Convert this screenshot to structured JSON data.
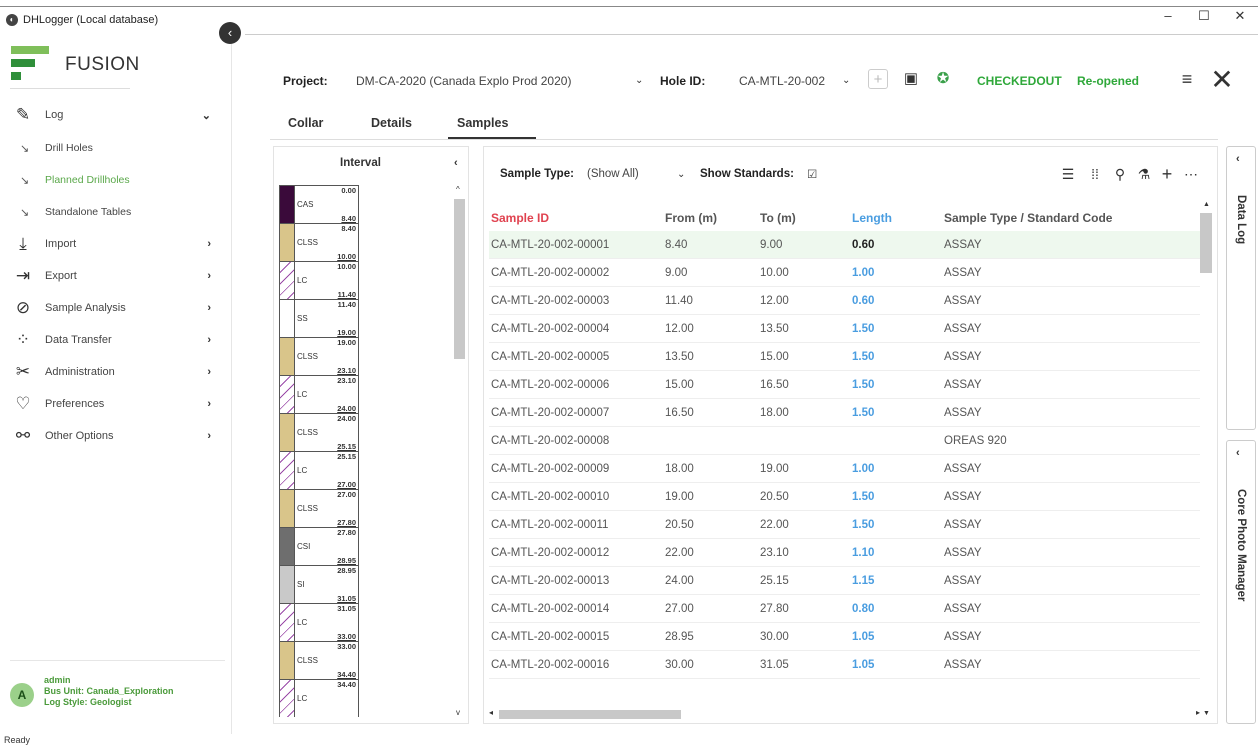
{
  "window": {
    "title": "DHLogger (Local database)",
    "minimize": "–",
    "maximize": "☐",
    "close": "✕"
  },
  "app": {
    "logo_text": "FUSION"
  },
  "nav": {
    "log": "Log",
    "sub": [
      "Drill Holes",
      "Planned Drillholes",
      "Standalone Tables"
    ],
    "items": [
      "Import",
      "Export",
      "Sample Analysis",
      "Data Transfer",
      "Administration",
      "Preferences",
      "Other Options"
    ]
  },
  "user": {
    "initial": "A",
    "name": "admin",
    "bus_unit": "Bus Unit: Canada_Exploration",
    "log_style": "Log Style: Geologist"
  },
  "status": "Ready",
  "header": {
    "project_label": "Project:",
    "project_value": "DM-CA-2020 (Canada Explo Prod 2020)",
    "hole_label": "Hole ID:",
    "hole_value": "CA-MTL-20-002",
    "checkout": "CHECKEDOUT",
    "reopened": "Re-opened"
  },
  "tabs": [
    "Collar",
    "Details",
    "Samples"
  ],
  "interval": {
    "title": "Interval",
    "items": [
      {
        "code": "CAS",
        "from": "0.00",
        "to": "8.40",
        "color": "#3a0a3a",
        "hatch": false
      },
      {
        "code": "CLSS",
        "from": "8.40",
        "to": "10.00",
        "color": "#d9c58a",
        "hatch": false
      },
      {
        "code": "LC",
        "from": "10.00",
        "to": "11.40",
        "color": "#ffffff",
        "hatch": true
      },
      {
        "code": "SS",
        "from": "11.40",
        "to": "19.00",
        "color": "#ffffff",
        "hatch": false
      },
      {
        "code": "CLSS",
        "from": "19.00",
        "to": "23.10",
        "color": "#d9c58a",
        "hatch": false
      },
      {
        "code": "LC",
        "from": "23.10",
        "to": "24.00",
        "color": "#ffffff",
        "hatch": true
      },
      {
        "code": "CLSS",
        "from": "24.00",
        "to": "25.15",
        "color": "#d9c58a",
        "hatch": false
      },
      {
        "code": "LC",
        "from": "25.15",
        "to": "27.00",
        "color": "#ffffff",
        "hatch": true
      },
      {
        "code": "CLSS",
        "from": "27.00",
        "to": "27.80",
        "color": "#d9c58a",
        "hatch": false
      },
      {
        "code": "CSI",
        "from": "27.80",
        "to": "28.95",
        "color": "#6e6e6e",
        "hatch": false
      },
      {
        "code": "SI",
        "from": "28.95",
        "to": "31.05",
        "color": "#c9c9c9",
        "hatch": false
      },
      {
        "code": "LC",
        "from": "31.05",
        "to": "33.00",
        "color": "#ffffff",
        "hatch": true
      },
      {
        "code": "CLSS",
        "from": "33.00",
        "to": "34.40",
        "color": "#d9c58a",
        "hatch": false
      },
      {
        "code": "LC",
        "from": "34.40",
        "to": "",
        "color": "#ffffff",
        "hatch": true
      }
    ]
  },
  "samples": {
    "type_label": "Sample Type:",
    "type_value": "(Show All)",
    "standards_label": "Show Standards:",
    "standards_check": "☑",
    "columns": [
      "Sample ID",
      "From (m)",
      "To (m)",
      "Length",
      "Sample Type / Standard Code"
    ],
    "rows": [
      [
        "CA-MTL-20-002-00001",
        "8.40",
        "9.00",
        "0.60",
        "ASSAY"
      ],
      [
        "CA-MTL-20-002-00002",
        "9.00",
        "10.00",
        "1.00",
        "ASSAY"
      ],
      [
        "CA-MTL-20-002-00003",
        "11.40",
        "12.00",
        "0.60",
        "ASSAY"
      ],
      [
        "CA-MTL-20-002-00004",
        "12.00",
        "13.50",
        "1.50",
        "ASSAY"
      ],
      [
        "CA-MTL-20-002-00005",
        "13.50",
        "15.00",
        "1.50",
        "ASSAY"
      ],
      [
        "CA-MTL-20-002-00006",
        "15.00",
        "16.50",
        "1.50",
        "ASSAY"
      ],
      [
        "CA-MTL-20-002-00007",
        "16.50",
        "18.00",
        "1.50",
        "ASSAY"
      ],
      [
        "CA-MTL-20-002-00008",
        "",
        "",
        "",
        "OREAS 920"
      ],
      [
        "CA-MTL-20-002-00009",
        "18.00",
        "19.00",
        "1.00",
        "ASSAY"
      ],
      [
        "CA-MTL-20-002-00010",
        "19.00",
        "20.50",
        "1.50",
        "ASSAY"
      ],
      [
        "CA-MTL-20-002-00011",
        "20.50",
        "22.00",
        "1.50",
        "ASSAY"
      ],
      [
        "CA-MTL-20-002-00012",
        "22.00",
        "23.10",
        "1.10",
        "ASSAY"
      ],
      [
        "CA-MTL-20-002-00013",
        "24.00",
        "25.15",
        "1.15",
        "ASSAY"
      ],
      [
        "CA-MTL-20-002-00014",
        "27.00",
        "27.80",
        "0.80",
        "ASSAY"
      ],
      [
        "CA-MTL-20-002-00015",
        "28.95",
        "30.00",
        "1.05",
        "ASSAY"
      ],
      [
        "CA-MTL-20-002-00016",
        "30.00",
        "31.05",
        "1.05",
        "ASSAY"
      ]
    ]
  },
  "side_tabs": [
    "Data Log",
    "Core Photo Manager"
  ]
}
